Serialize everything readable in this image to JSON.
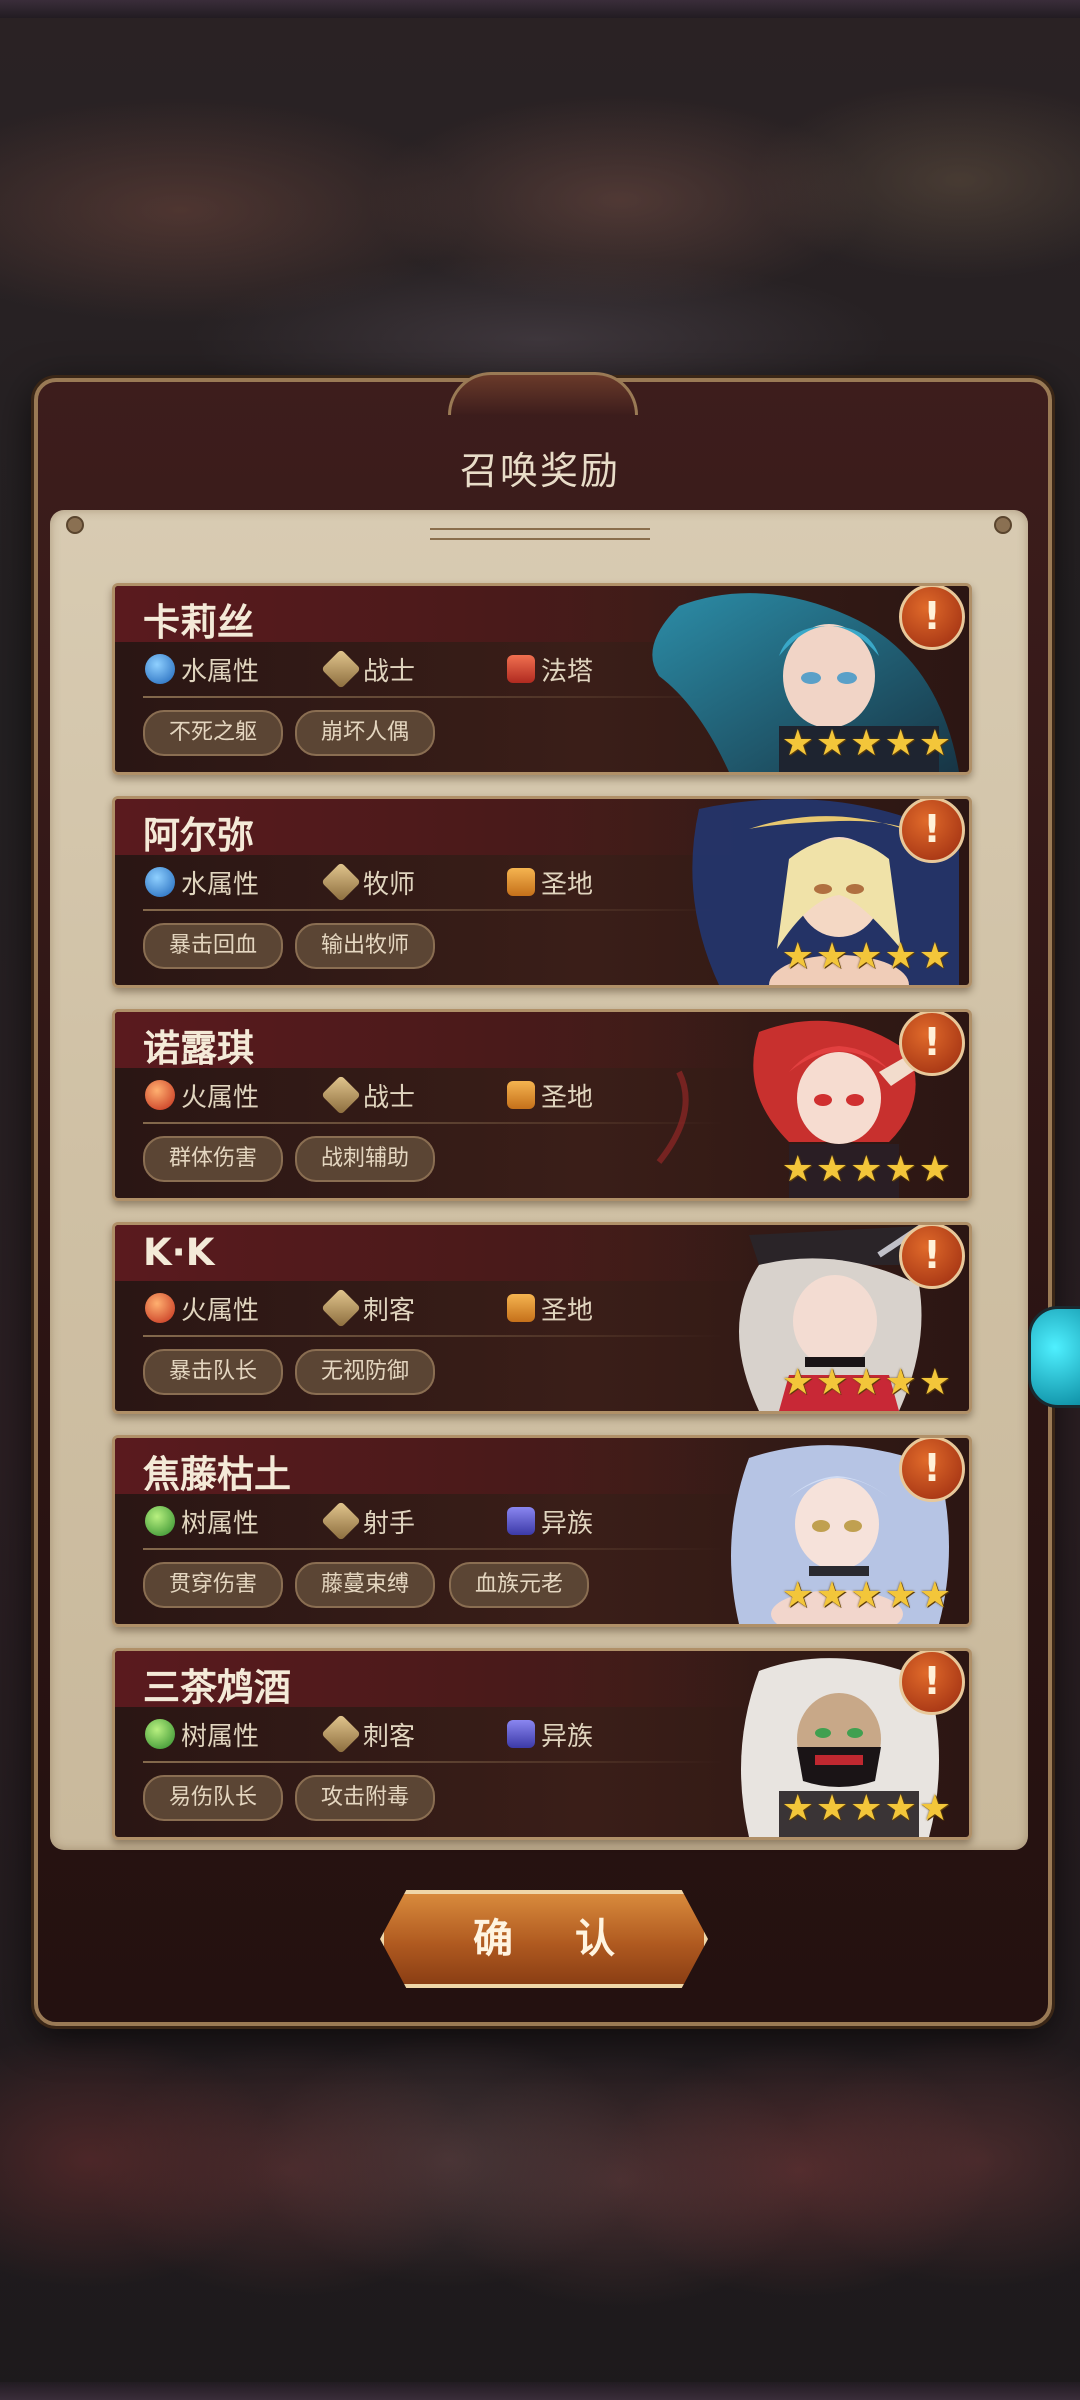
{
  "dialog": {
    "title": "召唤奖励",
    "confirm_label": "确 认"
  },
  "heroes": [
    {
      "name": "卡莉丝",
      "element": "水属性",
      "element_icon": "water-icon",
      "class": "战士",
      "camp": "法塔",
      "camp_color": "#d03a2a",
      "tags": [
        "不死之躯",
        "崩坏人偶"
      ],
      "stars": 5
    },
    {
      "name": "阿尔弥",
      "element": "水属性",
      "element_icon": "water-icon",
      "class": "牧师",
      "camp": "圣地",
      "camp_color": "#e08a2a",
      "tags": [
        "暴击回血",
        "输出牧师"
      ],
      "stars": 5
    },
    {
      "name": "诺露琪",
      "element": "火属性",
      "element_icon": "fire-icon",
      "class": "战士",
      "camp": "圣地",
      "camp_color": "#e08a2a",
      "tags": [
        "群体伤害",
        "战刺辅助"
      ],
      "stars": 5
    },
    {
      "name": "K·K",
      "element": "火属性",
      "element_icon": "fire-icon",
      "class": "刺客",
      "camp": "圣地",
      "camp_color": "#e08a2a",
      "tags": [
        "暴击队长",
        "无视防御"
      ],
      "stars": 5
    },
    {
      "name": "焦藤枯土",
      "element": "树属性",
      "element_icon": "tree-icon",
      "class": "射手",
      "camp": "异族",
      "camp_color": "#5a56d8",
      "tags": [
        "贯穿伤害",
        "藤蔓束缚",
        "血族元老"
      ],
      "stars": 5
    },
    {
      "name": "三茶鸩酒",
      "element": "树属性",
      "element_icon": "tree-icon",
      "class": "刺客",
      "camp": "异族",
      "camp_color": "#5a56d8",
      "tags": [
        "易伤队长",
        "攻击附毒"
      ],
      "stars": 5
    }
  ]
}
